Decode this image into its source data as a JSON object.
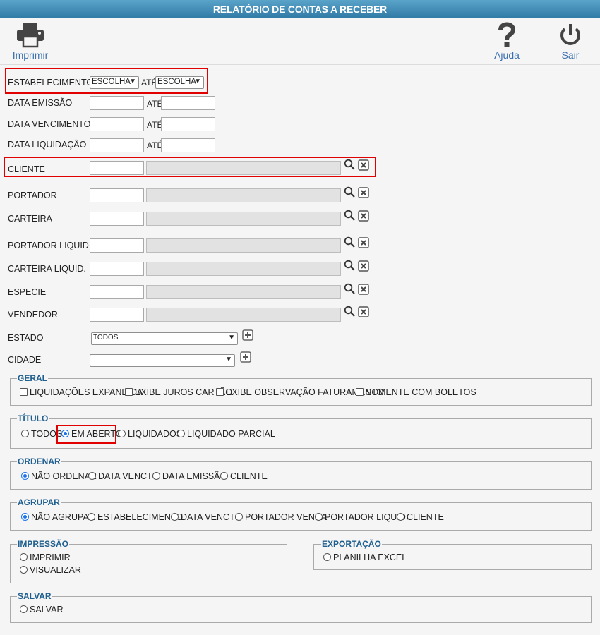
{
  "window": {
    "title": "RELATÓRIO DE CONTAS A RECEBER"
  },
  "toolbar": {
    "print_label": "Imprimir",
    "help_label": "Ajuda",
    "exit_label": "Sair"
  },
  "filters": {
    "estabelecimento": {
      "label": "ESTABELECIMENTO",
      "from": "ESCOLHA",
      "to_label": "ATÉ",
      "to": "ESCOLHA"
    },
    "data_emissao": {
      "label": "DATA EMISSÃO",
      "to_label": "ATÉ"
    },
    "data_vencimento": {
      "label": "DATA VENCIMENTO",
      "to_label": "ATÉ"
    },
    "data_liquidacao": {
      "label": "DATA LIQUIDAÇÃO",
      "to_label": "ATÉ"
    },
    "cliente": {
      "label": "CLIENTE"
    },
    "portador": {
      "label": "PORTADOR"
    },
    "carteira": {
      "label": "CARTEIRA"
    },
    "portador_liquid": {
      "label": "PORTADOR LIQUID."
    },
    "carteira_liquid": {
      "label": "CARTEIRA LIQUID."
    },
    "especie": {
      "label": "ESPECIE"
    },
    "vendedor": {
      "label": "VENDEDOR"
    },
    "estado": {
      "label": "ESTADO",
      "value": "TODOS"
    },
    "cidade": {
      "label": "CIDADE",
      "value": ""
    }
  },
  "geral": {
    "legend": "GERAL",
    "options": [
      "LIQUIDAÇÕES EXPANDIDA",
      "EXIBE JUROS CARTÃO",
      "EXIBE OBSERVAÇÃO FATURAMENTO",
      "SOMENTE COM BOLETOS"
    ]
  },
  "titulo": {
    "legend": "TÍTULO",
    "options": [
      "TODOS",
      "EM ABERTO",
      "LIQUIDADOS",
      "LIQUIDADO PARCIAL"
    ],
    "selected": "EM ABERTO"
  },
  "ordenar": {
    "legend": "ORDENAR",
    "options": [
      "NÃO ORDENAR",
      "DATA VENCTO",
      "DATA EMISSÃO",
      "CLIENTE"
    ],
    "selected": "NÃO ORDENAR"
  },
  "agrupar": {
    "legend": "AGRUPAR",
    "options": [
      "NÃO AGRUPAR",
      "ESTABELECIMENTO",
      "DATA VENCTO",
      "PORTADOR VENDA",
      "PORTADOR LIQUID.",
      "CLIENTE"
    ],
    "selected": "NÃO AGRUPAR"
  },
  "impressao": {
    "legend": "IMPRESSÃO",
    "options": [
      "IMPRIMIR",
      "VISUALIZAR"
    ]
  },
  "exportacao": {
    "legend": "EXPORTAÇÃO",
    "options": [
      "PLANILHA EXCEL"
    ]
  },
  "salvar": {
    "legend": "SALVAR",
    "options": [
      "SALVAR"
    ]
  },
  "colors": {
    "title_bar": "#3a8bb8",
    "legend_text": "#1f5f8f",
    "highlight": "#e00000",
    "toolbar_label": "#3a6fb0"
  }
}
